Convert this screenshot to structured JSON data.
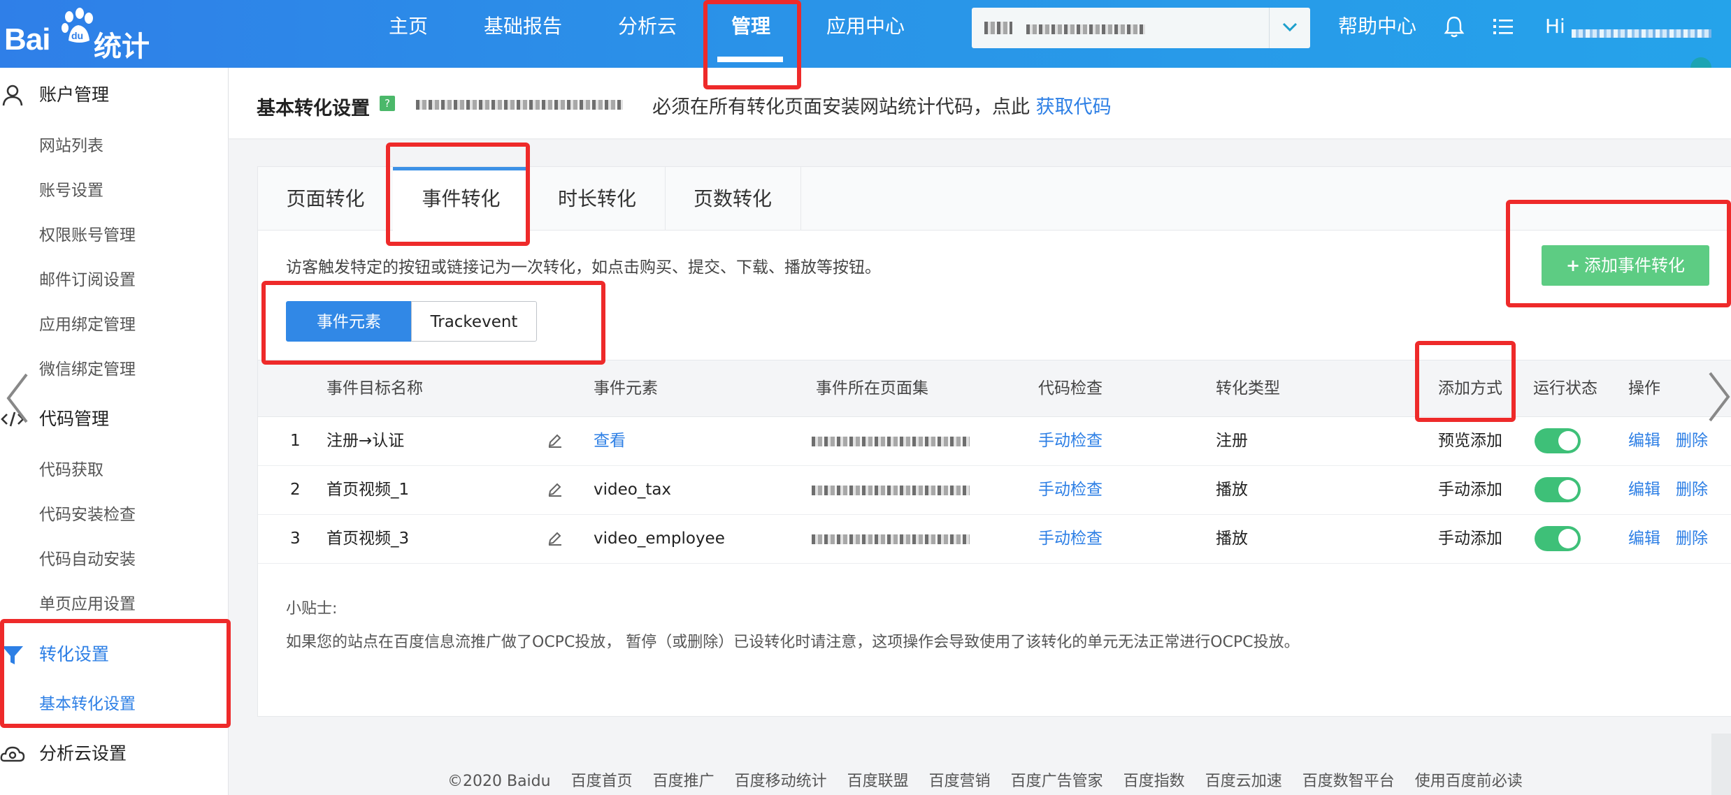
{
  "brand": {
    "logo_text": "Bai",
    "logo_paw_text": "du",
    "logo_suffix": "统计"
  },
  "nav": [
    {
      "label": "主页"
    },
    {
      "label": "基础报告"
    },
    {
      "label": "分析云"
    },
    {
      "label": "管理",
      "active": true
    },
    {
      "label": "应用中心"
    }
  ],
  "site_select": {
    "value": ""
  },
  "header_right": {
    "help": "帮助中心",
    "hi": "Hi"
  },
  "sidebar": {
    "groups": [
      {
        "label": "账户管理",
        "icon": "user-icon",
        "items": [
          "网站列表",
          "账号设置",
          "权限账号管理",
          "邮件订阅设置",
          "应用绑定管理",
          "微信绑定管理"
        ]
      },
      {
        "label": "代码管理",
        "icon": "code-icon",
        "items": [
          "代码获取",
          "代码安装检查",
          "代码自动安装",
          "单页应用设置"
        ]
      },
      {
        "label": "转化设置",
        "icon": "filter-icon",
        "active": true,
        "items": [
          "基本转化设置"
        ]
      },
      {
        "label": "分析云设置",
        "icon": "cloud-gear-icon",
        "items": []
      }
    ]
  },
  "header": {
    "title": "基本转化设置",
    "help_badge": "?",
    "hint_text": "必须在所有转化页面安装网站统计代码，点此",
    "hint_link": "获取代码"
  },
  "tabs": [
    {
      "label": "页面转化"
    },
    {
      "label": "事件转化",
      "active": true
    },
    {
      "label": "时长转化"
    },
    {
      "label": "页数转化"
    }
  ],
  "description": "访客触发特定的按钮或链接记为一次转化，如点击购买、提交、下载、播放等按钮。",
  "add_button": "添加事件转化",
  "segments": [
    {
      "label": "事件元素",
      "active": true
    },
    {
      "label": "Trackevent"
    }
  ],
  "table": {
    "headers": [
      "事件目标名称",
      "事件元素",
      "事件所在页面集",
      "代码检查",
      "转化类型",
      "添加方式",
      "运行状态",
      "操作"
    ],
    "rows": [
      {
        "index": "1",
        "name": "注册→认证",
        "element": "查看",
        "element_is_link": true,
        "check": "手动检查",
        "type": "注册",
        "method": "预览添加",
        "enabled": true,
        "edit": "编辑",
        "delete": "删除"
      },
      {
        "index": "2",
        "name": "首页视频_1",
        "element": "video_tax",
        "element_is_link": false,
        "check": "手动检查",
        "type": "播放",
        "method": "手动添加",
        "enabled": true,
        "edit": "编辑",
        "delete": "删除"
      },
      {
        "index": "3",
        "name": "首页视频_3",
        "element": "video_employee",
        "element_is_link": false,
        "check": "手动检查",
        "type": "播放",
        "method": "手动添加",
        "enabled": true,
        "edit": "编辑",
        "delete": "删除"
      }
    ]
  },
  "tips": {
    "title": "小贴士:",
    "body": "如果您的站点在百度信息流推广做了OCPC投放， 暂停（或删除）已设转化时请注意，这项操作会导致使用了该转化的单元无法正常进行OCPC投放。"
  },
  "footer": [
    "©2020 Baidu",
    "百度首页",
    "百度推广",
    "百度移动统计",
    "百度联盟",
    "百度营销",
    "百度广告管家",
    "百度指数",
    "百度云加速",
    "百度数智平台",
    "使用百度前必读"
  ],
  "colors": {
    "brand_blue": "#2f7fe8",
    "link": "#2d7fe5",
    "green": "#5dcc83",
    "annotation_red": "#ee2a2a"
  }
}
